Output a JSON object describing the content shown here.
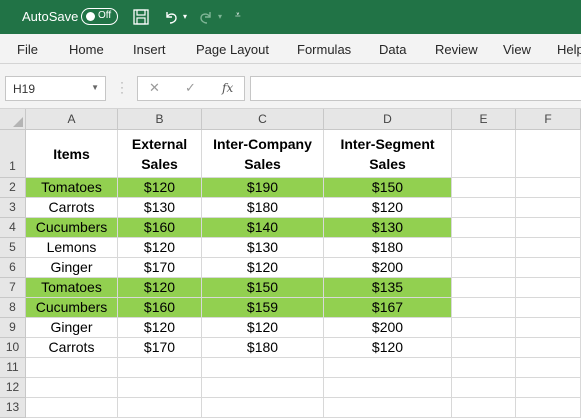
{
  "titlebar": {
    "autosave_label": "AutoSave",
    "autosave_state": "Off",
    "icons": [
      "save-icon",
      "undo-icon",
      "redo-icon",
      "customize-toolbar-icon"
    ],
    "bg_color": "#217346"
  },
  "ribbon_tabs": [
    "File",
    "Home",
    "Insert",
    "Page Layout",
    "Formulas",
    "Data",
    "Review",
    "View",
    "Help"
  ],
  "formula_bar": {
    "name_box": "H19",
    "cancel_symbol": "✕",
    "enter_symbol": "✓",
    "fx_label": "fx",
    "formula_value": ""
  },
  "columns": [
    "A",
    "B",
    "C",
    "D",
    "E",
    "F"
  ],
  "rows": [
    "1",
    "2",
    "3",
    "4",
    "5",
    "6",
    "7",
    "8",
    "9",
    "10",
    "11",
    "12",
    "13"
  ],
  "highlight_color": "#92d050",
  "header_row": {
    "a": "Items",
    "b": "External Sales",
    "c": "Inter-Company Sales",
    "d": "Inter-Segment Sales"
  },
  "data_rows": [
    {
      "item": "Tomatoes",
      "external": "$120",
      "intercompany": "$190",
      "intersegment": "$150",
      "highlight": true
    },
    {
      "item": "Carrots",
      "external": "$130",
      "intercompany": "$180",
      "intersegment": "$120",
      "highlight": false
    },
    {
      "item": "Cucumbers",
      "external": "$160",
      "intercompany": "$140",
      "intersegment": "$130",
      "highlight": true
    },
    {
      "item": "Lemons",
      "external": "$120",
      "intercompany": "$130",
      "intersegment": "$180",
      "highlight": false
    },
    {
      "item": "Ginger",
      "external": "$170",
      "intercompany": "$120",
      "intersegment": "$200",
      "highlight": false
    },
    {
      "item": "Tomatoes",
      "external": "$120",
      "intercompany": "$150",
      "intersegment": "$135",
      "highlight": true
    },
    {
      "item": "Cucumbers",
      "external": "$160",
      "intercompany": "$159",
      "intersegment": "$167",
      "highlight": true
    },
    {
      "item": "Ginger",
      "external": "$120",
      "intercompany": "$120",
      "intersegment": "$200",
      "highlight": false
    },
    {
      "item": "Carrots",
      "external": "$170",
      "intercompany": "$180",
      "intersegment": "$120",
      "highlight": false
    }
  ]
}
